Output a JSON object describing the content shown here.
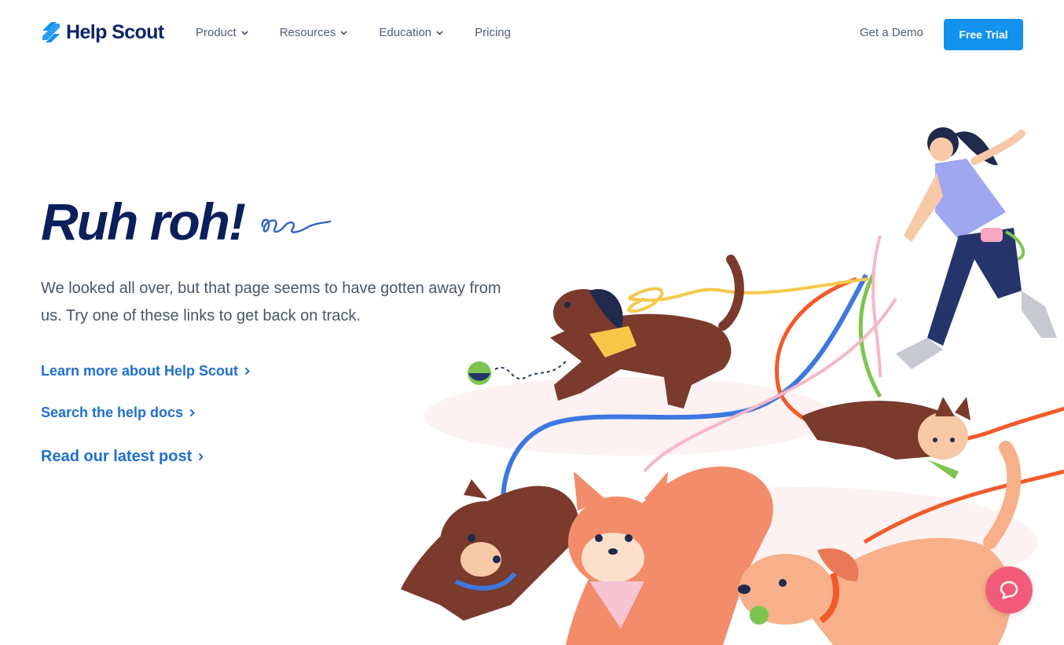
{
  "brand": {
    "name": "Help Scout",
    "logo_icon": "help-scout-mark-icon",
    "color": "#1292ee",
    "navy": "#0a1f5c"
  },
  "nav": {
    "items": [
      {
        "label": "Product",
        "has_dropdown": true
      },
      {
        "label": "Resources",
        "has_dropdown": true
      },
      {
        "label": "Education",
        "has_dropdown": true
      },
      {
        "label": "Pricing",
        "has_dropdown": false
      }
    ],
    "demo_label": "Get a Demo",
    "trial_label": "Free Trial"
  },
  "hero": {
    "title": "Ruh roh!",
    "body": "We looked all over, but that page seems to have gotten away from us. Try one of these links to get back on track.",
    "links": [
      {
        "label": "Learn more about Help Scout"
      },
      {
        "label": "Search the help docs"
      },
      {
        "label": "Read our latest post"
      }
    ],
    "link_color": "#1f6fd1"
  },
  "illustration": {
    "description_icon": "dog-walker-illustration-icon"
  },
  "chat": {
    "icon": "chat-bubble-icon",
    "color": "#f25c7a"
  }
}
